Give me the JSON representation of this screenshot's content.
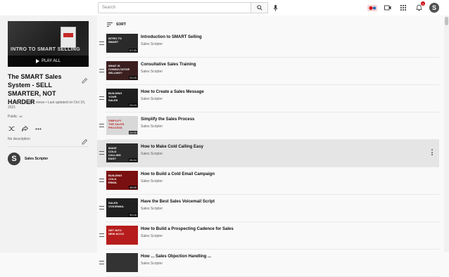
{
  "header": {
    "search_placeholder": "Search",
    "notification_count": "9",
    "account_initial": "S"
  },
  "playlist": {
    "thumb_title": "INTRO TO SMART SELLING",
    "play_all": "PLAY ALL",
    "title": "The SMART Sales System - SELL SMARTER, NOT HARDER",
    "meta": "24 videos • 5,812 views • Last updated on Oct 16, 2021",
    "visibility": "Public",
    "description": "No description",
    "owner_initial": "S",
    "owner": "Sales Scripter"
  },
  "list": {
    "sort_label": "SORT",
    "items": [
      {
        "title": "Introduction to SMART Selling",
        "channel": "Sales Scripter",
        "duration": "07:20",
        "thumb_text": "INTRO TO SMART",
        "bg": "#2a2a2a"
      },
      {
        "title": "Consultative Sales Training",
        "channel": "Sales Scripter",
        "duration": "29:29",
        "thumb_text": "WHAT IS CONSULTATIVE SELLING?",
        "bg": "#3b1f1f"
      },
      {
        "title": "How to Create a Sales Message",
        "channel": "Sales Scripter",
        "duration": "23:19",
        "thumb_text": "BUILDING YOUR SALES",
        "bg": "#1f1f1f"
      },
      {
        "title": "Simplify the Sales Process",
        "channel": "Sales Scripter",
        "duration": "24:00",
        "thumb_text": "SIMPLIFY THE SALES PROCESS",
        "bg": "#d8d8d8"
      },
      {
        "title": "How to Make Cold Calling Easy",
        "channel": "Sales Scripter",
        "duration": "26:44",
        "thumb_text": "MAKE COLD CALLING EASY",
        "bg": "#2c2c2c"
      },
      {
        "title": "How to Build a Cold Email Campaign",
        "channel": "Sales Scripter",
        "duration": "48:55",
        "thumb_text": "BUILDING COLD EMAIL",
        "bg": "#7a1010"
      },
      {
        "title": "Have the Best Sales Voicemail Script",
        "channel": "Sales Scripter",
        "duration": "30:16",
        "thumb_text": "SALES VOICEMAIL",
        "bg": "#202020"
      },
      {
        "title": "How to Build a Prospecting Cadence for Sales",
        "channel": "Sales Scripter",
        "duration": "",
        "thumb_text": "GET INTO NEW ACCO",
        "bg": "#b71c1c"
      },
      {
        "title": "How ... Sales Objection Handling ...",
        "channel": "Sales Scripter",
        "duration": "",
        "thumb_text": "",
        "bg": "#333333"
      }
    ]
  },
  "colors": {
    "accent": "#cc0000",
    "text_primary": "#0f0f0f",
    "text_secondary": "#606060"
  }
}
